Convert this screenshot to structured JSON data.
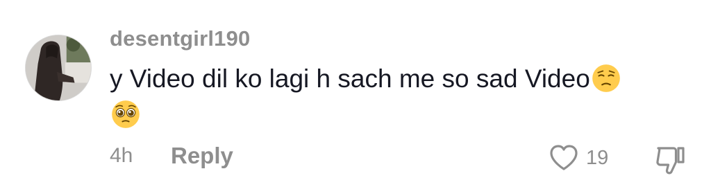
{
  "comment": {
    "username": "desentgirl190",
    "text": "y Video dil ko lagi h sach me so sad Video",
    "emojis": [
      "pensive-face-emoji",
      "pleading-face-emoji"
    ],
    "time": "4h",
    "reply_label": "Reply",
    "like_count": "19"
  },
  "icons": {
    "avatar": "avatar",
    "like": "heart-outline-icon",
    "dislike": "thumbs-down-outline-icon"
  },
  "colors": {
    "text_primary": "#161823",
    "text_secondary": "#8e8e8e",
    "emoji_yellow": "#ffcc4d"
  }
}
